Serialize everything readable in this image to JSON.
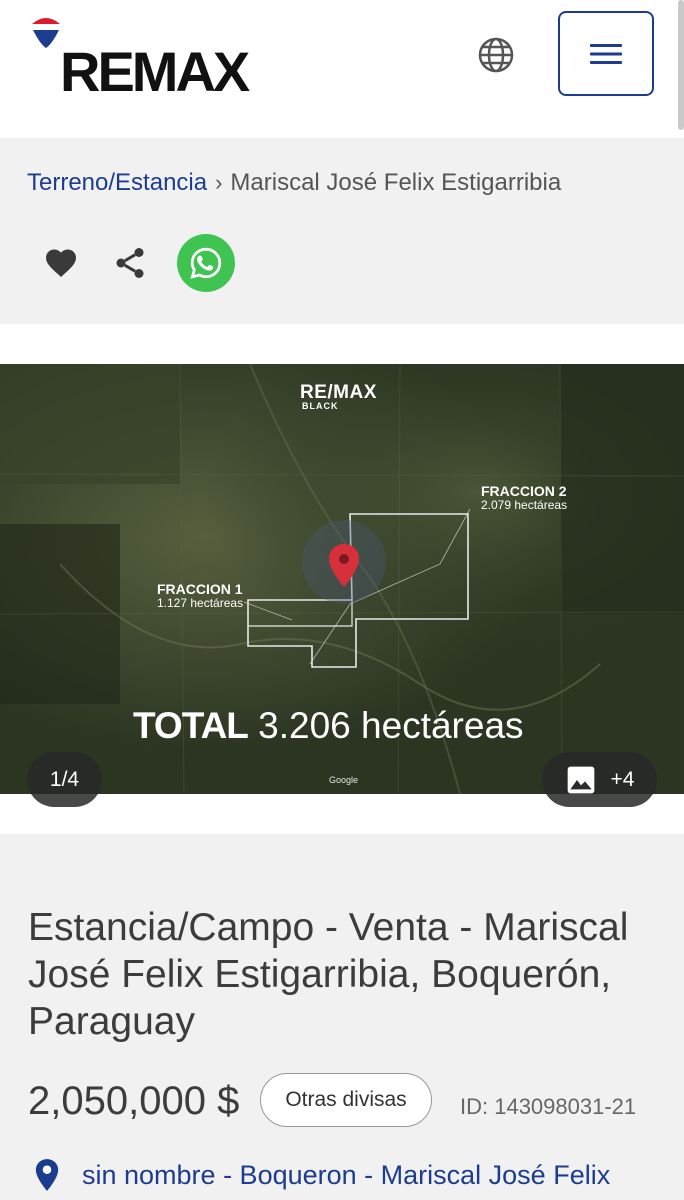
{
  "header": {
    "brand": "REMAX",
    "icons": {
      "language": "globe-icon",
      "menu": "hamburger-menu-icon"
    },
    "brand_colors": {
      "red": "#dc1c2e",
      "blue": "#1c3d8f"
    }
  },
  "breadcrumb": {
    "link": "Terreno/Estancia",
    "separator": "›",
    "current": "Mariscal José Felix Estigarribia"
  },
  "actions": {
    "favorite_icon": "heart-icon",
    "share_icon": "share-icon",
    "whatsapp_icon": "whatsapp-icon",
    "whatsapp_color": "#3fc351"
  },
  "photo": {
    "brand": "RE/MAX",
    "brand_sub": "BLACK",
    "fraction1_title": "FRACCION 1",
    "fraction1_area": "1.127 hectáreas",
    "fraction2_title": "FRACCION 2",
    "fraction2_area": "2.079 hectáreas",
    "total_bold": "TOTAL",
    "total_value": "3.206 hectáreas",
    "map_credit": "Google",
    "counter": "1/4",
    "more_photos": "+4"
  },
  "listing": {
    "title": "Estancia/Campo - Venta - Mariscal José Felix Estigarribia, Boquerón, Paraguay",
    "price": "2,050,000 $",
    "currency_button": "Otras divisas",
    "id": "ID: 143098031-21",
    "location_icon": "map-pin-icon",
    "location": "sin nombre - Boqueron - Mariscal José Felix"
  }
}
